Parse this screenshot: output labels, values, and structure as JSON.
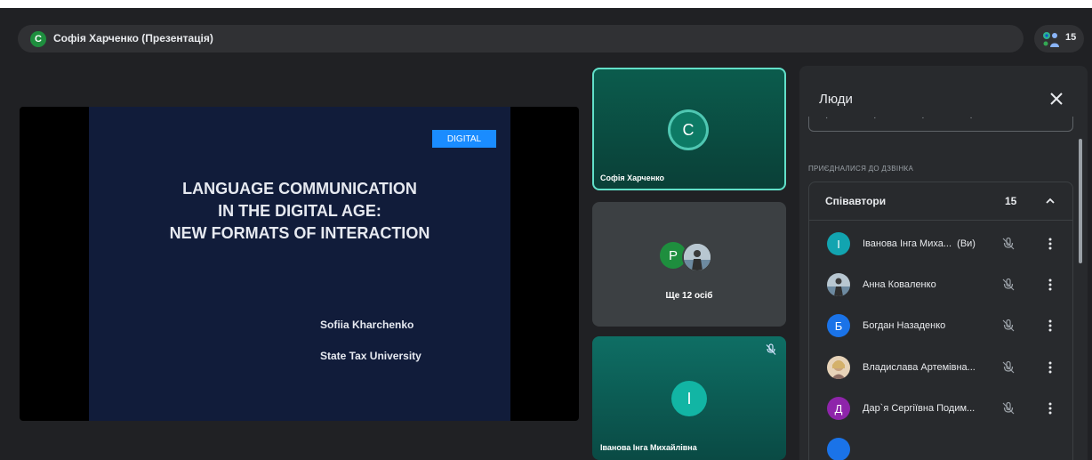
{
  "header": {
    "presenter_initial": "С",
    "presenter_title": "Софія Харченко (Презентація)",
    "participant_count": "15"
  },
  "slide": {
    "tag": "DIGITAL",
    "title_lines": [
      "LANGUAGE COMMUNICATION",
      "IN THE DIGITAL AGE:",
      "NEW FORMATS OF INTERACTION"
    ],
    "author": "Sofiia Kharchenko",
    "university": "State Tax University"
  },
  "tiles": {
    "speaker": {
      "initial": "С",
      "name": "Софія Харченко"
    },
    "others": {
      "initial": "Р",
      "label": "Ще 12 осіб"
    },
    "self": {
      "initial": "І",
      "name": "Іванова Інга Михайлівна"
    }
  },
  "panel": {
    "title": "Люди",
    "section_label": "ПРИЄДНАЛИСЯ ДО ДЗВІНКА",
    "group_name": "Співавтори",
    "group_count": "15",
    "participants": [
      {
        "initial": "І",
        "name": "Іванова Інга Миха...",
        "suffix": "(Ви)",
        "color": "#12a4b0"
      },
      {
        "initial": "",
        "name": "Анна Коваленко",
        "suffix": "",
        "color": "#b0bec5"
      },
      {
        "initial": "Б",
        "name": "Богдан Назаденко",
        "suffix": "",
        "color": "#1a73e8"
      },
      {
        "initial": "",
        "name": "Владислава Артемівна...",
        "suffix": "",
        "color": "#c9a27e"
      },
      {
        "initial": "Д",
        "name": "Дар`я Сергіївна Подим...",
        "suffix": "",
        "color": "#8e24aa"
      }
    ]
  },
  "icons": {
    "people": "people-icon",
    "mic_off": "mic-off-icon",
    "close": "close-icon",
    "chevron": "chevron-up-icon",
    "more": "more-vert-icon"
  }
}
